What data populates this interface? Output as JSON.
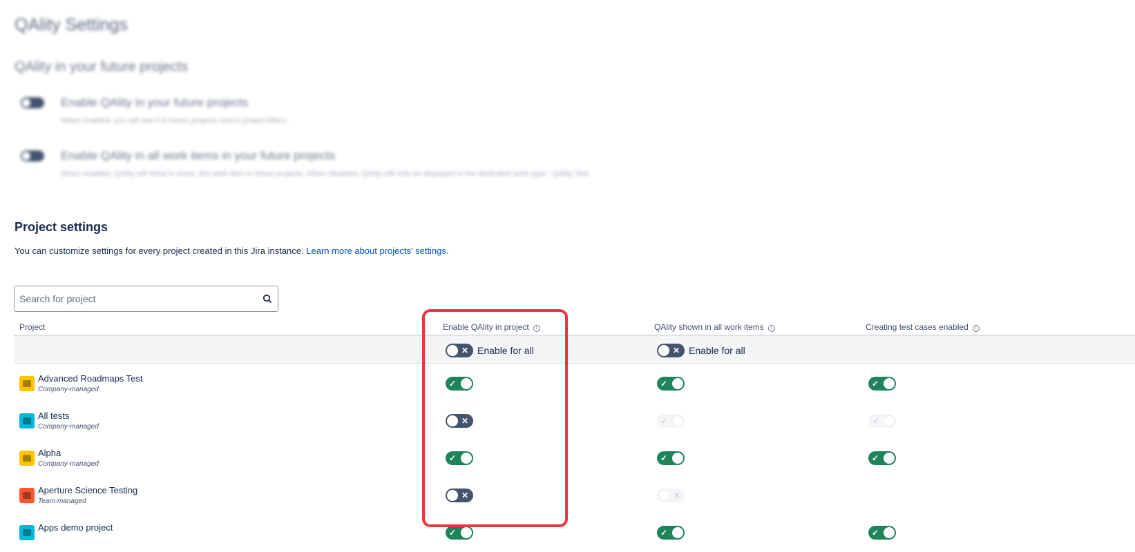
{
  "page_title": "QAlity Settings",
  "future_section": {
    "heading": "QAlity in your future projects",
    "options": [
      {
        "title": "Enable QAlity in your future projects",
        "description": "When enabled, you will see it in future projects and in project filters."
      },
      {
        "title": "Enable QAlity in all work items in your future projects",
        "description": "When enabled, QAlity will show in every Jira work item in future projects. When disabled, QAlity will only be displayed in the dedicated work type - QAlity Test."
      }
    ]
  },
  "project_settings": {
    "heading": "Project settings",
    "description": "You can customize settings for every project created in this Jira instance.",
    "learn_more_link": "Learn more about projects' settings.",
    "search_placeholder": "Search for project",
    "columns": {
      "project": "Project",
      "enable": "Enable QAlity in project",
      "shown": "QAlity shown in all work items",
      "creating": "Creating test cases enabled"
    },
    "enable_all_label": "Enable for all",
    "projects": [
      {
        "name": "Advanced Roadmaps Test",
        "type": "Company-managed",
        "icon_color": "#ffc400",
        "enable": "on",
        "shown": "on",
        "creating": "on"
      },
      {
        "name": "All tests",
        "type": "Company-managed",
        "icon_color": "#00b8d9",
        "enable": "off",
        "shown": "disabled-on",
        "creating": "disabled-on"
      },
      {
        "name": "Alpha",
        "type": "Company-managed",
        "icon_color": "#ffc400",
        "enable": "on",
        "shown": "on",
        "creating": "on"
      },
      {
        "name": "Aperture Science Testing",
        "type": "Team-managed",
        "icon_color": "#ff5630",
        "enable": "off",
        "shown": "disabled-off",
        "creating": "none"
      },
      {
        "name": "Apps demo project",
        "type": "",
        "icon_color": "#00b8d9",
        "enable": "on",
        "shown": "on",
        "creating": "on"
      }
    ]
  },
  "colors": {
    "toggle_on": "#1f845a",
    "toggle_off": "#44546f",
    "link": "#0052cc",
    "highlight": "#f0353d"
  }
}
